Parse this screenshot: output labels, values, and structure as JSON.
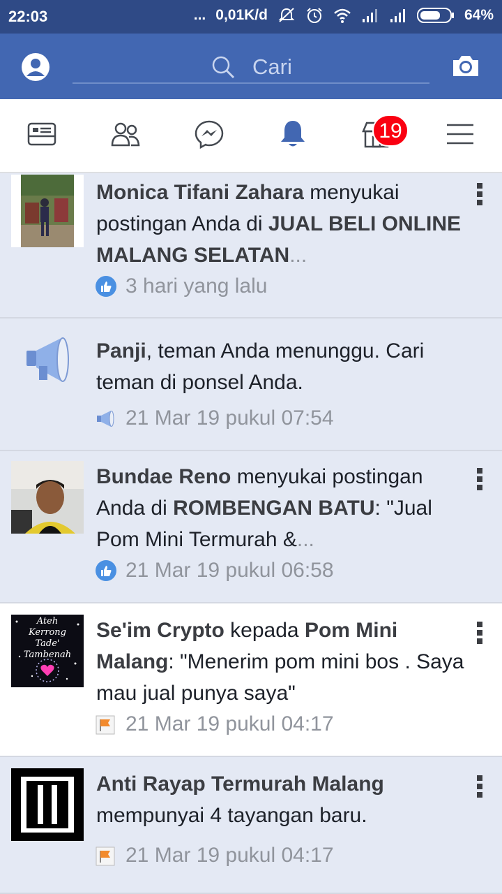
{
  "status_bar": {
    "time": "22:03",
    "dots": "...",
    "network_speed": "0,01K/d",
    "battery": "64%"
  },
  "header": {
    "search_placeholder": "Cari",
    "icons": [
      "profile-icon",
      "search-icon",
      "camera-icon"
    ]
  },
  "tabs": {
    "items": [
      "news-feed",
      "friends",
      "messenger",
      "notifications",
      "marketplace",
      "menu"
    ],
    "active": "notifications",
    "marketplace_badge": "19"
  },
  "notifications": [
    {
      "actor": "Monica Tifani Zahara",
      "text1": " menyukai postingan Anda di ",
      "target": "JUAL BELI ONLINE MALANG SELATAN",
      "ellipsis": "...",
      "time": "3 hari yang lalu",
      "type_icon": "like-icon",
      "read": false
    },
    {
      "actor": "Panji",
      "text1": ", teman Anda menunggu. Cari teman di ponsel Anda.",
      "time": "21 Mar 19 pukul 07:54",
      "type_icon": "megaphone-icon",
      "read": false
    },
    {
      "actor": "Bundae Reno",
      "text1": " menyukai postingan Anda di ",
      "target": "ROMBENGAN BATU",
      "text2": ": \"Jual Pom Mini Termurah &",
      "ellipsis": "...",
      "time": "21 Mar 19 pukul 06:58",
      "type_icon": "like-icon",
      "read": false
    },
    {
      "actor": "Se'im Crypto",
      "text1": " kepada ",
      "target": "Pom Mini Malang",
      "text2": ": \"Menerim pom mini bos . Saya mau jual punya saya\"",
      "time": "21 Mar 19 pukul 04:17",
      "type_icon": "page-flag-icon",
      "thumb_lines": [
        "Ateh",
        "Kerrong",
        "Tade'",
        "Tambenah"
      ],
      "read": true
    },
    {
      "actor": "Anti Rayap Termurah Malang",
      "text1": " mempunyai 4 tayangan baru.",
      "time": "21 Mar 19 pukul 04:17",
      "type_icon": "page-flag-icon",
      "read": false
    }
  ],
  "colors": {
    "header_blue": "#4267b2",
    "status_blue": "#2f4a86",
    "unread_bg": "#e4e9f4",
    "badge_red": "#fa0011",
    "like_blue": "#4a90e2"
  }
}
